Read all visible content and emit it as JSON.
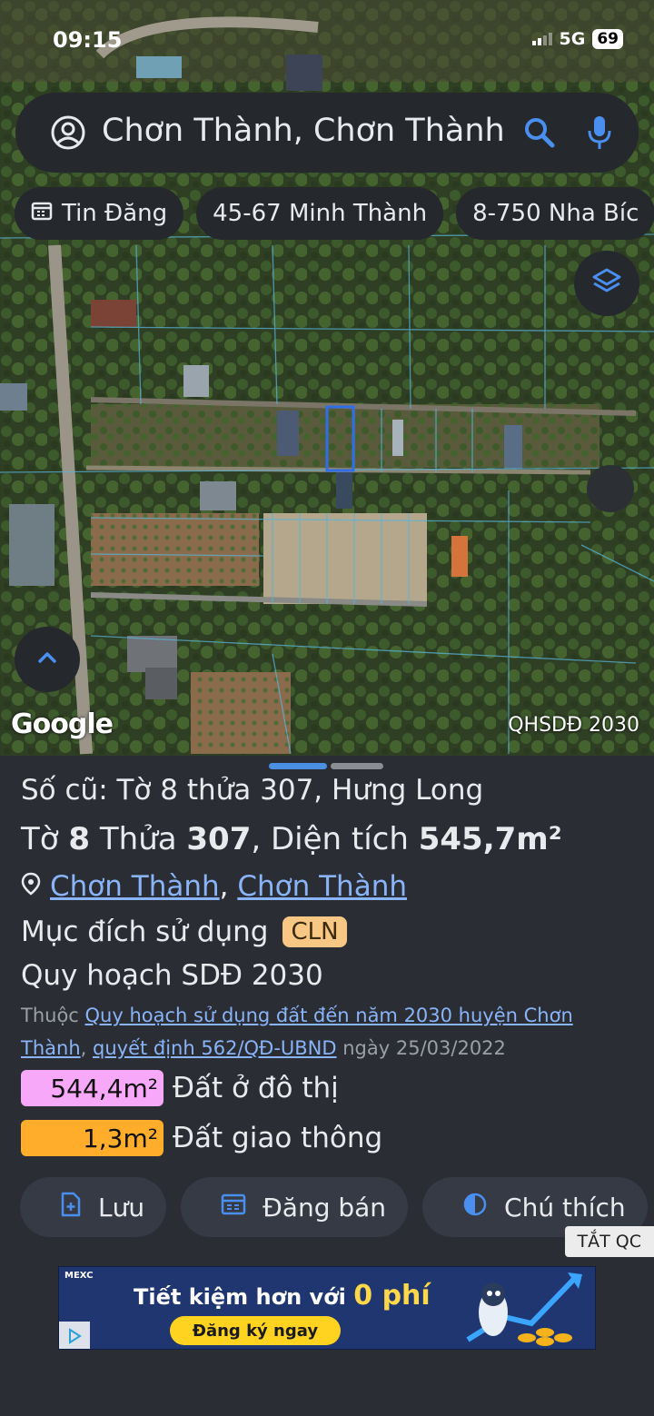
{
  "status": {
    "time": "09:15",
    "network": "5G",
    "battery": "69"
  },
  "search": {
    "query": "Chơn Thành, Chơn Thành"
  },
  "chips": [
    {
      "label": "Tin Đăng",
      "icon": "calendar-icon"
    },
    {
      "label": "45-67 Minh Thành"
    },
    {
      "label": "8-750 Nha Bíc"
    }
  ],
  "map": {
    "logo": "Google",
    "layer_label": "QHSDĐ 2030"
  },
  "parcel": {
    "old_label": "Số cũ: Tờ 8 thửa 307, Hưng Long",
    "main_prefix_1": "Tờ ",
    "sheet_no": "8",
    "main_prefix_2": " Thửa ",
    "parcel_no": "307",
    "main_prefix_3": ", Diện tích ",
    "area": "545,7m²",
    "location_1": "Chơn Thành",
    "location_sep": ",",
    "location_2": "Chơn Thành",
    "purpose_label": "Mục đích sử dụng",
    "purpose_code": "CLN",
    "plan_label": "Quy hoạch SDĐ 2030",
    "belongs_prefix": "Thuộc",
    "belongs_link": "Quy hoạch sử dụng đất đến năm 2030 huyện Chơn Thành",
    "belongs_sep": ",",
    "decision_link": "quyết định 562/QĐ-UBND",
    "date_text": "ngày 25/03/2022",
    "zones": [
      {
        "area": "544,4m²",
        "label": "Đất ở đô thị",
        "color": "#f8a8f8"
      },
      {
        "area": "1,3m²",
        "label": "Đất giao thông",
        "color": "#ffad2a"
      }
    ]
  },
  "actions": [
    {
      "label": "Lưu",
      "icon": "add-document-icon"
    },
    {
      "label": "Đăng bán",
      "icon": "calendar-icon"
    },
    {
      "label": "Chú thích",
      "icon": "contrast-icon"
    }
  ],
  "ad": {
    "close_label": "TẮT QC",
    "brand": "MEXC",
    "headline": "Tiết kiệm hơn với",
    "headline_highlight": "0 phí",
    "cta": "Đăng ký ngay"
  }
}
